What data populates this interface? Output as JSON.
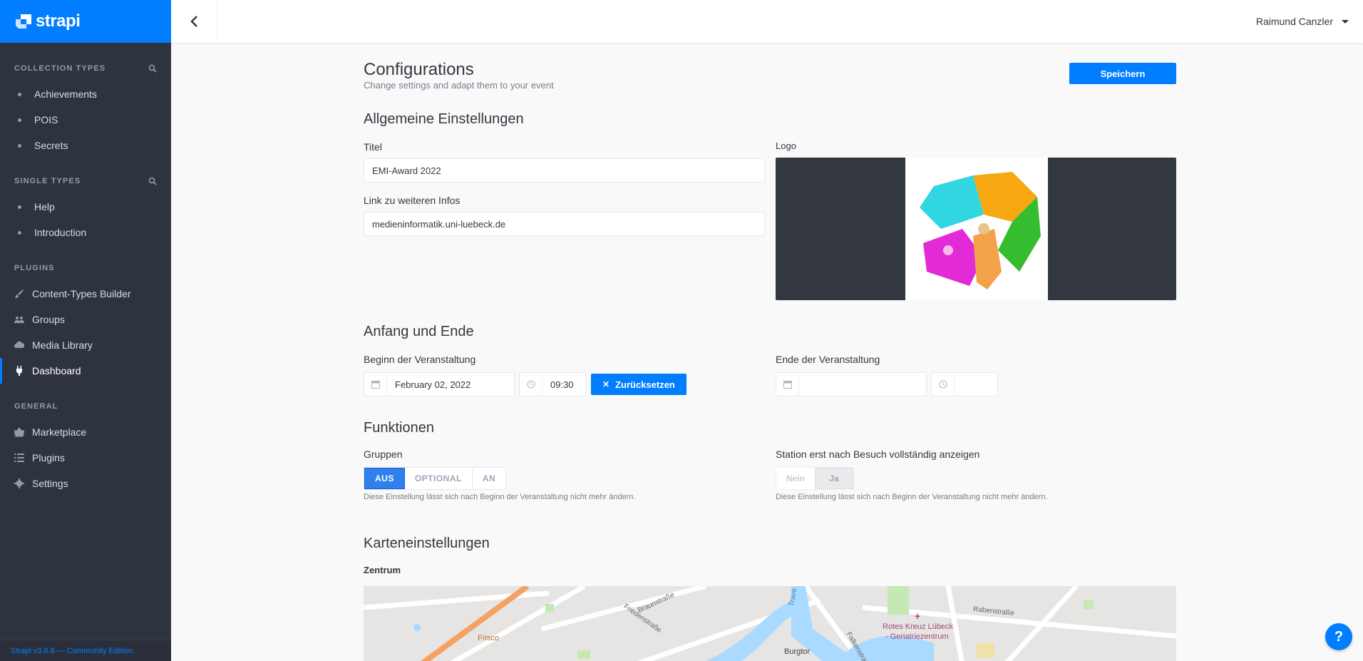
{
  "brand": {
    "name": "strapi"
  },
  "sidebar": {
    "collection_types": {
      "title": "Collection Types",
      "items": [
        {
          "label": "Achievements"
        },
        {
          "label": "POIS"
        },
        {
          "label": "Secrets"
        }
      ]
    },
    "single_types": {
      "title": "Single Types",
      "items": [
        {
          "label": "Help"
        },
        {
          "label": "Introduction"
        }
      ]
    },
    "plugins": {
      "title": "Plugins",
      "items": [
        {
          "label": "Content-Types Builder",
          "icon": "brush-icon"
        },
        {
          "label": "Groups",
          "icon": "users-icon"
        },
        {
          "label": "Media Library",
          "icon": "cloud-icon"
        },
        {
          "label": "Dashboard",
          "icon": "plug-icon",
          "active": true
        }
      ]
    },
    "general": {
      "title": "General",
      "items": [
        {
          "label": "Marketplace",
          "icon": "basket-icon"
        },
        {
          "label": "Plugins",
          "icon": "list-icon"
        },
        {
          "label": "Settings",
          "icon": "gear-icon"
        }
      ]
    },
    "footer": "Strapi v3.6.8 — Community Edition"
  },
  "header": {
    "user_name": "Raimund Canzler"
  },
  "page": {
    "title": "Configurations",
    "subtitle": "Change settings and adapt them to your event",
    "save_label": "Speichern"
  },
  "general_settings": {
    "heading": "Allgemeine Einstellungen",
    "title_label": "Titel",
    "title_value": "EMI-Award 2022",
    "link_label": "Link zu weiteren Infos",
    "link_value": "medieninformatik.uni-luebeck.de",
    "logo_label": "Logo"
  },
  "schedule": {
    "heading": "Anfang und Ende",
    "start_label": "Beginn der Veranstaltung",
    "start_date": "February 02, 2022",
    "start_time": "09:30",
    "reset_label": "Zurücksetzen",
    "end_label": "Ende der Veranstaltung",
    "end_date": "",
    "end_time": ""
  },
  "functions": {
    "heading": "Funktionen",
    "groups_label": "Gruppen",
    "groups_options": [
      "AUS",
      "OPTIONAL",
      "AN"
    ],
    "groups_selected": "AUS",
    "groups_hint": "Diese Einstellung lässt sich nach Beginn der Veranstaltung nicht mehr ändern.",
    "station_label": "Station erst nach Besuch vollständig anzeigen",
    "station_options": [
      "Nein",
      "Ja"
    ],
    "station_selected": "Ja",
    "station_hint": "Diese Einstellung lässt sich nach Beginn der Veranstaltung nicht mehr ändern."
  },
  "map_settings": {
    "heading": "Karteneinstellungen",
    "center_label": "Zentrum",
    "map_labels": [
      "Braunstraße",
      "Friedenstraße",
      "Frisco",
      "Burgtor",
      "Rotes Kreuz Lübeck",
      "- Geriatriezentrum",
      "Rabenstraße",
      "Trave",
      "Falkenstraße"
    ]
  },
  "help": {
    "label": "?"
  },
  "colors": {
    "accent": "#007eff",
    "sidebar": "#2e3340",
    "background": "#f9f9f9"
  }
}
